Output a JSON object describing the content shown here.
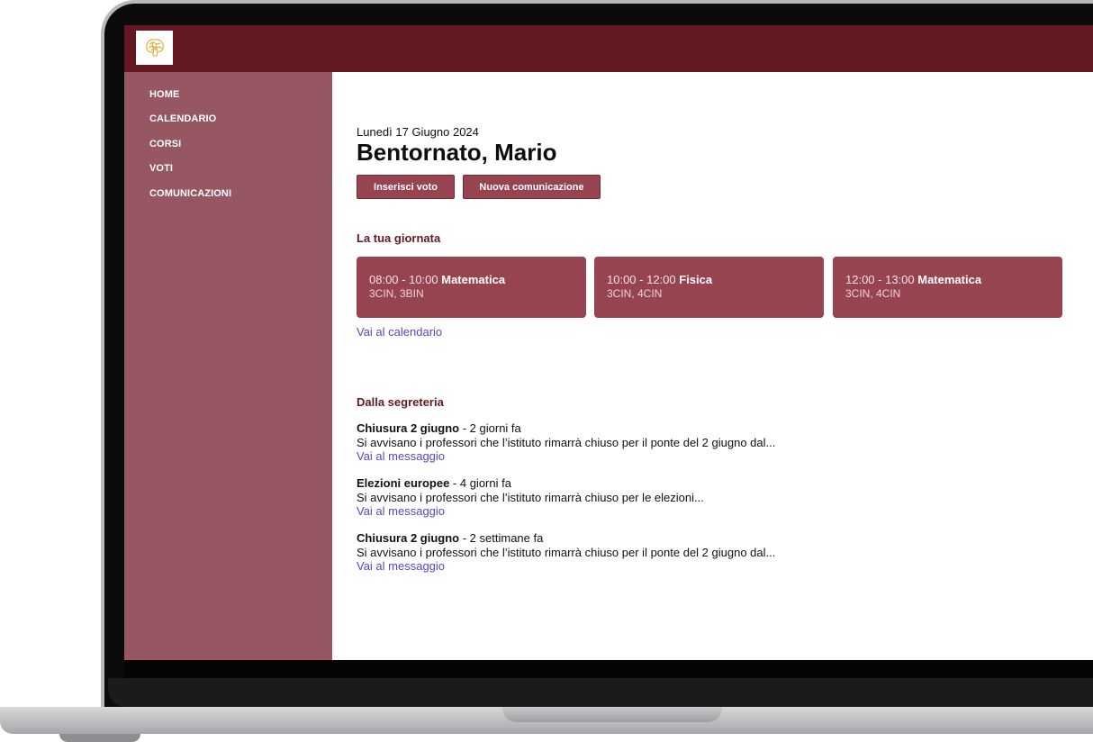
{
  "sidebar": {
    "items": [
      {
        "label": "HOME",
        "active": true
      },
      {
        "label": "CALENDARIO"
      },
      {
        "label": "CORSI"
      },
      {
        "label": "VOTI"
      },
      {
        "label": "COMUNICAZIONI"
      }
    ]
  },
  "header": {
    "date": "Lunedì 17 Giugno 2024",
    "welcome": "Bentornato, Mario"
  },
  "actions": {
    "insert_grade": "Inserisci voto",
    "new_communication": "Nuova comunicazione"
  },
  "day": {
    "title": "La tua giornata",
    "lessons": [
      {
        "time": "08:00 - 10:00",
        "subject": "Matematica",
        "classes": "3CIN, 3BIN"
      },
      {
        "time": "10:00 - 12:00",
        "subject": "Fisica",
        "classes": "3CIN, 4CIN"
      },
      {
        "time": "12:00 - 13:00",
        "subject": "Matematica",
        "classes": "3CIN, 4CIN"
      }
    ],
    "calendar_link": "Vai al calendario"
  },
  "office": {
    "title": "Dalla segreteria",
    "messages": [
      {
        "title": "Chiusura 2 giugno",
        "age": " - 2 giorni fa",
        "preview": "Si avvisano i professori che l’istituto rimarrà chiuso per il ponte del 2 giugno dal...",
        "link": "Vai al messaggio"
      },
      {
        "title": "Elezioni europee",
        "age": " - 4 giorni fa",
        "preview": "Si avvisano i professori che l’istituto rimarrà chiuso per le elezioni...",
        "link": "Vai al messaggio"
      },
      {
        "title": "Chiusura 2 giugno",
        "age": " - 2 settimane fa",
        "preview": "Si avvisano i professori che l’istituto rimarrà chiuso per il ponte del 2 giugno dal...",
        "link": "Vai al messaggio"
      }
    ]
  },
  "colors": {
    "topbar": "#641922",
    "sidebar": "#965762",
    "accent": "#984350",
    "link": "#5048c8",
    "logo_icon": "#e3a82e"
  },
  "icons": {
    "logo": "brain-icon"
  }
}
